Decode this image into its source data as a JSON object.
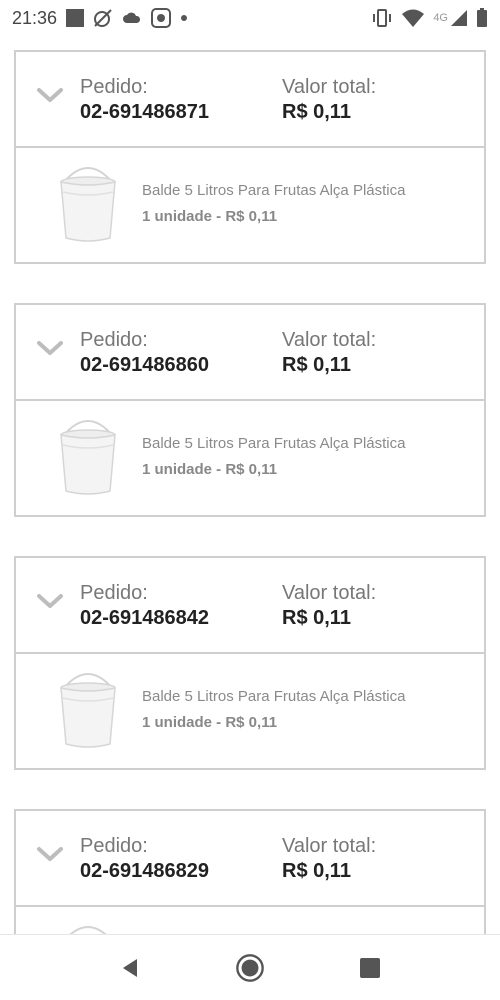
{
  "status_bar": {
    "time": "21:36",
    "network_label": "4G",
    "icons": [
      "square-notification-icon",
      "muted-notification-icon",
      "cloud-notification-icon",
      "app-notification-icon",
      "dot-icon",
      "vibrate-icon",
      "wifi-icon",
      "signal-icon",
      "battery-icon"
    ]
  },
  "orders": [
    {
      "order_label": "Pedido:",
      "order_number": "02-691486871",
      "total_label": "Valor total:",
      "total_value": "R$ 0,11",
      "item": {
        "name": "Balde 5 Litros Para Frutas Alça Plástica",
        "quantity_price": "1 unidade - R$ 0,11"
      }
    },
    {
      "order_label": "Pedido:",
      "order_number": "02-691486860",
      "total_label": "Valor total:",
      "total_value": "R$ 0,11",
      "item": {
        "name": "Balde 5 Litros Para Frutas Alça Plástica",
        "quantity_price": "1 unidade - R$ 0,11"
      }
    },
    {
      "order_label": "Pedido:",
      "order_number": "02-691486842",
      "total_label": "Valor total:",
      "total_value": "R$ 0,11",
      "item": {
        "name": "Balde 5 Litros Para Frutas Alça Plástica",
        "quantity_price": "1 unidade - R$ 0,11"
      }
    },
    {
      "order_label": "Pedido:",
      "order_number": "02-691486829",
      "total_label": "Valor total:",
      "total_value": "R$ 0,11",
      "item": {
        "name": "",
        "quantity_price": ""
      }
    }
  ],
  "nav_bar": {
    "icons": [
      "back-icon",
      "home-icon",
      "recents-icon"
    ]
  },
  "colors": {
    "border": "#cfcfcf",
    "text_primary": "#222222",
    "text_secondary": "#777777"
  }
}
